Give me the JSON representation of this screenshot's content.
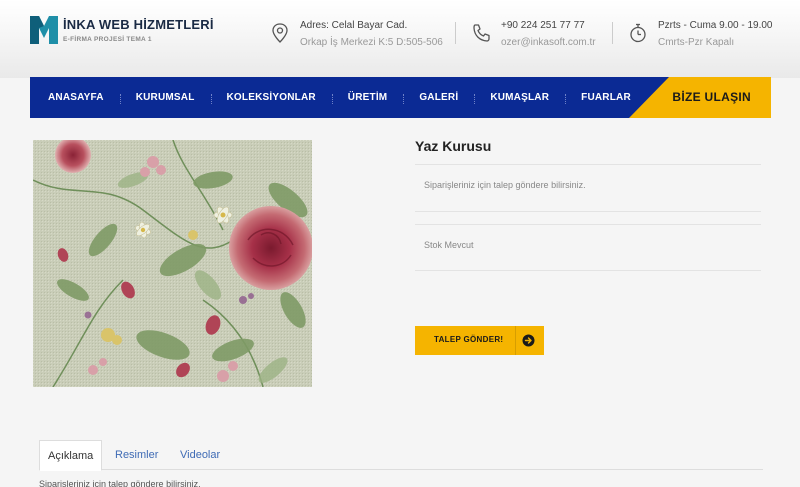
{
  "brand": {
    "title": "İNKA WEB HİZMETLERİ",
    "subtitle": "E-FİRMA PROJESİ TEMA 1"
  },
  "contact": {
    "address": {
      "line1": "Adres: Celal Bayar Cad.",
      "line2": "Orkap İş Merkezi K:5 D:505-506",
      "icon": "map-pin-icon"
    },
    "phone": {
      "line1": "+90 224 251 77 77",
      "line2": "ozer@inkasoft.com.tr",
      "icon": "phone-icon"
    },
    "hours": {
      "line1": "Pzrts - Cuma 9.00 - 19.00",
      "line2": "Cmrts-Pzr Kapalı",
      "icon": "stopwatch-icon"
    }
  },
  "nav": {
    "items": [
      "ANASAYFA",
      "KURUMSAL",
      "KOLEKSİYONLAR",
      "ÜRETİM",
      "GALERİ",
      "KUMAŞLAR",
      "FUARLAR"
    ],
    "cta": "BİZE ULAŞIN"
  },
  "product": {
    "title": "Yaz Kurusu",
    "description": "Siparişleriniz için talep göndere bilirsiniz.",
    "stock": "Stok Mevcut",
    "button": "TALEP GÖNDER!"
  },
  "tabs": {
    "items": [
      "Açıklama",
      "Resimler",
      "Videolar"
    ],
    "content": "Siparişleriniz için talep göndere bilirsiniz."
  },
  "colors": {
    "nav_bg": "#0b2a94",
    "accent": "#f5b400",
    "link": "#3f6bb5"
  }
}
